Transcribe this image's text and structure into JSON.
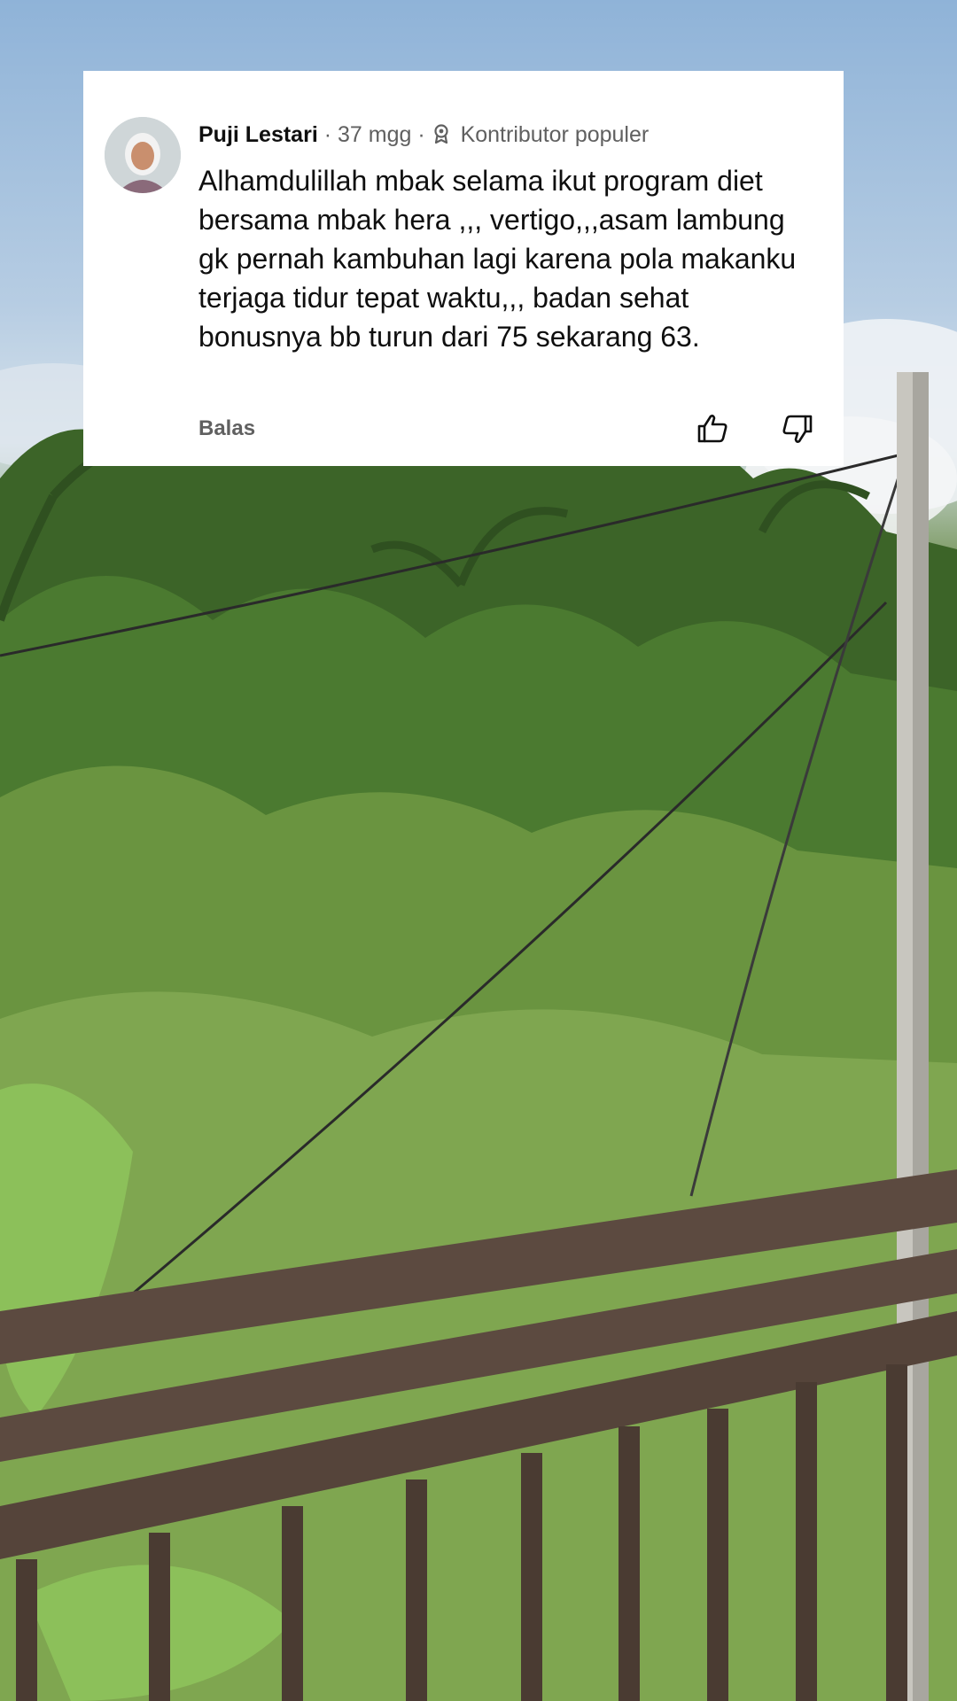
{
  "comment": {
    "author": "Puji Lestari",
    "separator_1": "·",
    "age": "37 mgg",
    "separator_2": "·",
    "badge_icon": "contributor-badge-icon",
    "badge_label": "Kontributor populer",
    "text": "Alhamdulillah mbak selama ikut program diet bersama mbak hera ,,, vertigo,,,asam lambung gk pernah kambuhan lagi karena pola makanku terjaga tidur tepat waktu,,, badan sehat bonusnya bb turun dari 75 sekarang 63.",
    "reply_label": "Balas",
    "like_icon": "thumbs-up-icon",
    "dislike_icon": "thumbs-down-icon"
  },
  "colors": {
    "card_background": "#ffffff",
    "author_text": "#0f0f0f",
    "meta_text": "#606060"
  }
}
